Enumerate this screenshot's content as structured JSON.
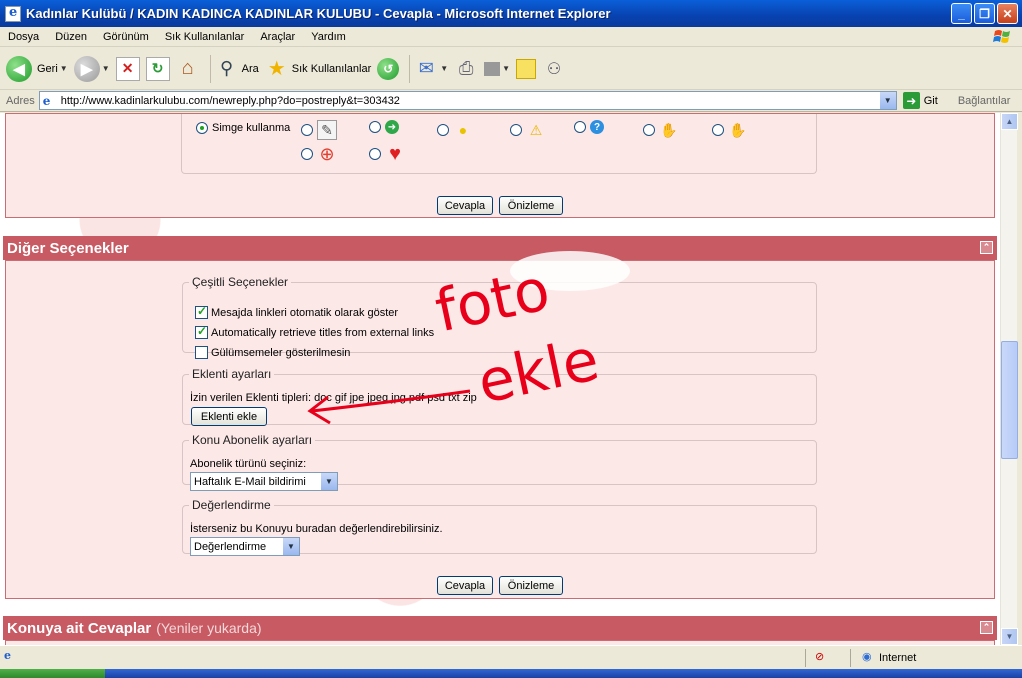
{
  "window": {
    "title": "Kadınlar Kulübü / KADIN KADINCA KADINLAR KULUBU - Cevapla - Microsoft Internet Explorer",
    "min_label": "_",
    "max_label": "❐",
    "close_label": "✕"
  },
  "menu": [
    "Dosya",
    "Düzen",
    "Görünüm",
    "Sık Kullanılanlar",
    "Araçlar",
    "Yardım"
  ],
  "toolbar": {
    "back_label": "Geri",
    "search_label": "Ara",
    "favorites_label": "Sık Kullanılanlar"
  },
  "address": {
    "label": "Adres",
    "url": "http://www.kadinlarkulubu.com/newreply.php?do=postreply&t=303432",
    "go_label": "Git",
    "links_label": "Bağlantılar"
  },
  "icons_row": {
    "no_icon_label": "Simge kullanma"
  },
  "buttons": {
    "reply": "Cevapla",
    "preview": "Önizleme"
  },
  "other_options": {
    "title": "Diğer Seçenekler",
    "misc": {
      "legend": "Çeşitli Seçenekler",
      "items": [
        {
          "label": "Mesajda linkleri otomatik olarak göster",
          "checked": true
        },
        {
          "label": "Automatically retrieve titles from external links",
          "checked": true
        },
        {
          "label": "Gülümsemeler gösterilmesin",
          "checked": false
        }
      ]
    },
    "attachments": {
      "legend": "Eklenti ayarları",
      "allowed": "İzin verilen Eklenti tipleri: doc gif jpe jpeg jpg pdf psd txt zip",
      "button": "Eklenti ekle"
    },
    "subscription": {
      "legend": "Konu Abonelik ayarları",
      "prompt": "Abonelik türünü seçiniz:",
      "selected": "Haftalık E-Mail bildirimi"
    },
    "rating": {
      "legend": "Değerlendirme",
      "prompt": "İsterseniz bu Konuyu buradan değerlendirebilirsiniz.",
      "selected": "Değerlendirme"
    }
  },
  "annotation": {
    "line1": "foto",
    "line2": "ekle",
    "color": "#e8001a"
  },
  "replies": {
    "title": "Konuya ait Cevaplar",
    "subtitle": "(Yeniler yukarda)"
  },
  "status": {
    "zone": "Internet"
  }
}
